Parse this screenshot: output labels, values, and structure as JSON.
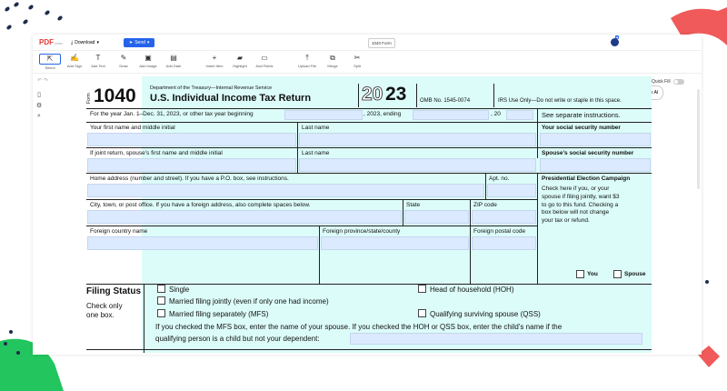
{
  "app": {
    "logo": "PDF",
    "logo_sub": "Liner",
    "download_label": "Download",
    "send_label": "Send",
    "doc_title": "1040 Form",
    "quick_fill_label": "Quick Fill",
    "ask_ai_label": "Ask AI",
    "tools": [
      {
        "label": "Select",
        "icon": "cursor-icon"
      },
      {
        "label": "Add Sign",
        "icon": "signature-icon"
      },
      {
        "label": "Add Text",
        "icon": "text-icon"
      },
      {
        "label": "Draw",
        "icon": "pen-icon"
      },
      {
        "label": "Add Image",
        "icon": "image-icon"
      },
      {
        "label": "Add Date",
        "icon": "calendar-icon"
      },
      {
        "label": "Insert Item",
        "icon": "plus-icon"
      },
      {
        "label": "Highlight",
        "icon": "highlighter-icon"
      },
      {
        "label": "Add Fields",
        "icon": "fields-icon"
      },
      {
        "label": "Upload File",
        "icon": "upload-icon"
      },
      {
        "label": "Merge",
        "icon": "merge-icon"
      },
      {
        "label": "Split",
        "icon": "split-icon"
      }
    ]
  },
  "form": {
    "form_word": "Form",
    "form_number": "1040",
    "dept": "Department of the Treasury—Internal Revenue Service",
    "title": "U.S. Individual Income Tax Return",
    "year_outline": "20",
    "year_bold": "23",
    "omb": "OMB No. 1545-0074",
    "irs_use": "IRS Use Only—Do not write or staple in this space.",
    "year_line_a": "For the year Jan. 1–Dec. 31, 2023, or other tax year beginning",
    "year_line_b": ", 2023, ending",
    "year_line_c": ", 20",
    "see_separate": "See separate instructions.",
    "first_name_label": "Your first name and middle initial",
    "last_name_label": "Last name",
    "ssn_label": "Your social security number",
    "spouse_first_label": "If joint return, spouse’s first name and middle initial",
    "spouse_last_label": "Last name",
    "spouse_ssn_label": "Spouse’s social security number",
    "address_label": "Home address (number and street). If you have a P.O. box, see instructions.",
    "apt_label": "Apt. no.",
    "pec_title": "Presidential Election Campaign",
    "pec_text": [
      "Check here if you, or your",
      "spouse if filing jointly, want $3",
      "to go to this fund. Checking a",
      "box below will not change",
      "your tax or refund."
    ],
    "pec_you": "You",
    "pec_spouse": "Spouse",
    "city_label": "City, town, or post office. If you have a foreign address, also complete spaces below.",
    "state_label": "State",
    "zip_label": "ZIP code",
    "country_label": "Foreign country name",
    "province_label": "Foreign province/state/county",
    "postal_label": "Foreign postal code",
    "filing_status_title": "Filing Status",
    "filing_status_sub": [
      "Check only",
      "one box."
    ],
    "fs_single": "Single",
    "fs_mfj": "Married filing jointly (even if only one had income)",
    "fs_mfs": "Married filing separately (MFS)",
    "fs_hoh": "Head of household (HOH)",
    "fs_qss": "Qualifying surviving spouse (QSS)",
    "mfs_note_1": "If you checked the MFS box, enter the name of your spouse. If you checked the HOH or QSS box, enter the child’s name if the",
    "mfs_note_2": "qualifying person is a child but not your dependent:"
  }
}
